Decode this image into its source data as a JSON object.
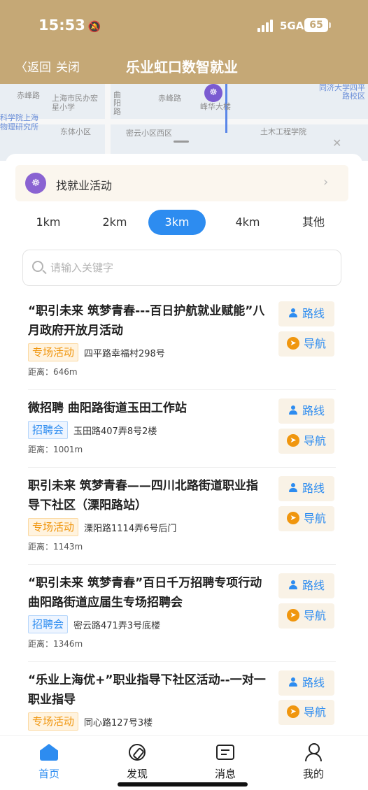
{
  "status_bar": {
    "time": "15:53",
    "network": "5GA",
    "battery": "65"
  },
  "nav": {
    "back_label": "返回",
    "close_label": "关闭",
    "title": "乐业虹口数智就业"
  },
  "map": {
    "labels": [
      "赤峰路",
      "上海市民办宏星小学",
      "曲阳路",
      "赤峰路",
      "峰华大楼",
      "同济大学四平路校区",
      "科学院上海物理研究所",
      "东体小区",
      "密云小区西区",
      "土木工程学院"
    ]
  },
  "activity": {
    "label": "找就业活动"
  },
  "distance_tabs": [
    "1km",
    "2km",
    "3km",
    "4km",
    "其他"
  ],
  "distance_active": "3km",
  "search": {
    "placeholder": "请输入关键字"
  },
  "labels": {
    "route": "路线",
    "navigate": "导航",
    "distance_prefix": "距离："
  },
  "items": [
    {
      "title": "“职引未来 筑梦青春---百日护航就业赋能”八月政府开放月活动",
      "tag": "专场活动",
      "tag_type": "special",
      "address": "四平路幸福村298号",
      "distance": "距离：646m"
    },
    {
      "title": "微招聘 曲阳路街道玉田工作站",
      "tag": "招聘会",
      "tag_type": "recruit",
      "address": "玉田路407弄8号2楼",
      "distance": "距离：1001m"
    },
    {
      "title": "职引未来 筑梦青春——四川北路街道职业指导下社区（溧阳路站）",
      "tag": "专场活动",
      "tag_type": "special",
      "address": "溧阳路1114弄6号后门",
      "distance": "距离：1143m"
    },
    {
      "title": "“职引未来 筑梦青春”百日千万招聘专项行动曲阳路街道应届生专场招聘会",
      "tag": "招聘会",
      "tag_type": "recruit",
      "address": "密云路471弄3号底楼",
      "distance": "距离：1346m"
    },
    {
      "title": "“乐业上海优+”职业指导下社区活动--一对一职业指导",
      "tag": "专场活动",
      "tag_type": "special",
      "address": "同心路127号3楼",
      "distance": ""
    }
  ],
  "tabbar": [
    {
      "label": "首页",
      "icon": "home-icon",
      "active": true
    },
    {
      "label": "发现",
      "icon": "compass-icon",
      "active": false
    },
    {
      "label": "消息",
      "icon": "message-icon",
      "active": false
    },
    {
      "label": "我的",
      "icon": "person-icon",
      "active": false
    }
  ],
  "colors": {
    "header": "#c5a876",
    "accent": "#2d8cf0",
    "special_tag": "#f0960e"
  }
}
